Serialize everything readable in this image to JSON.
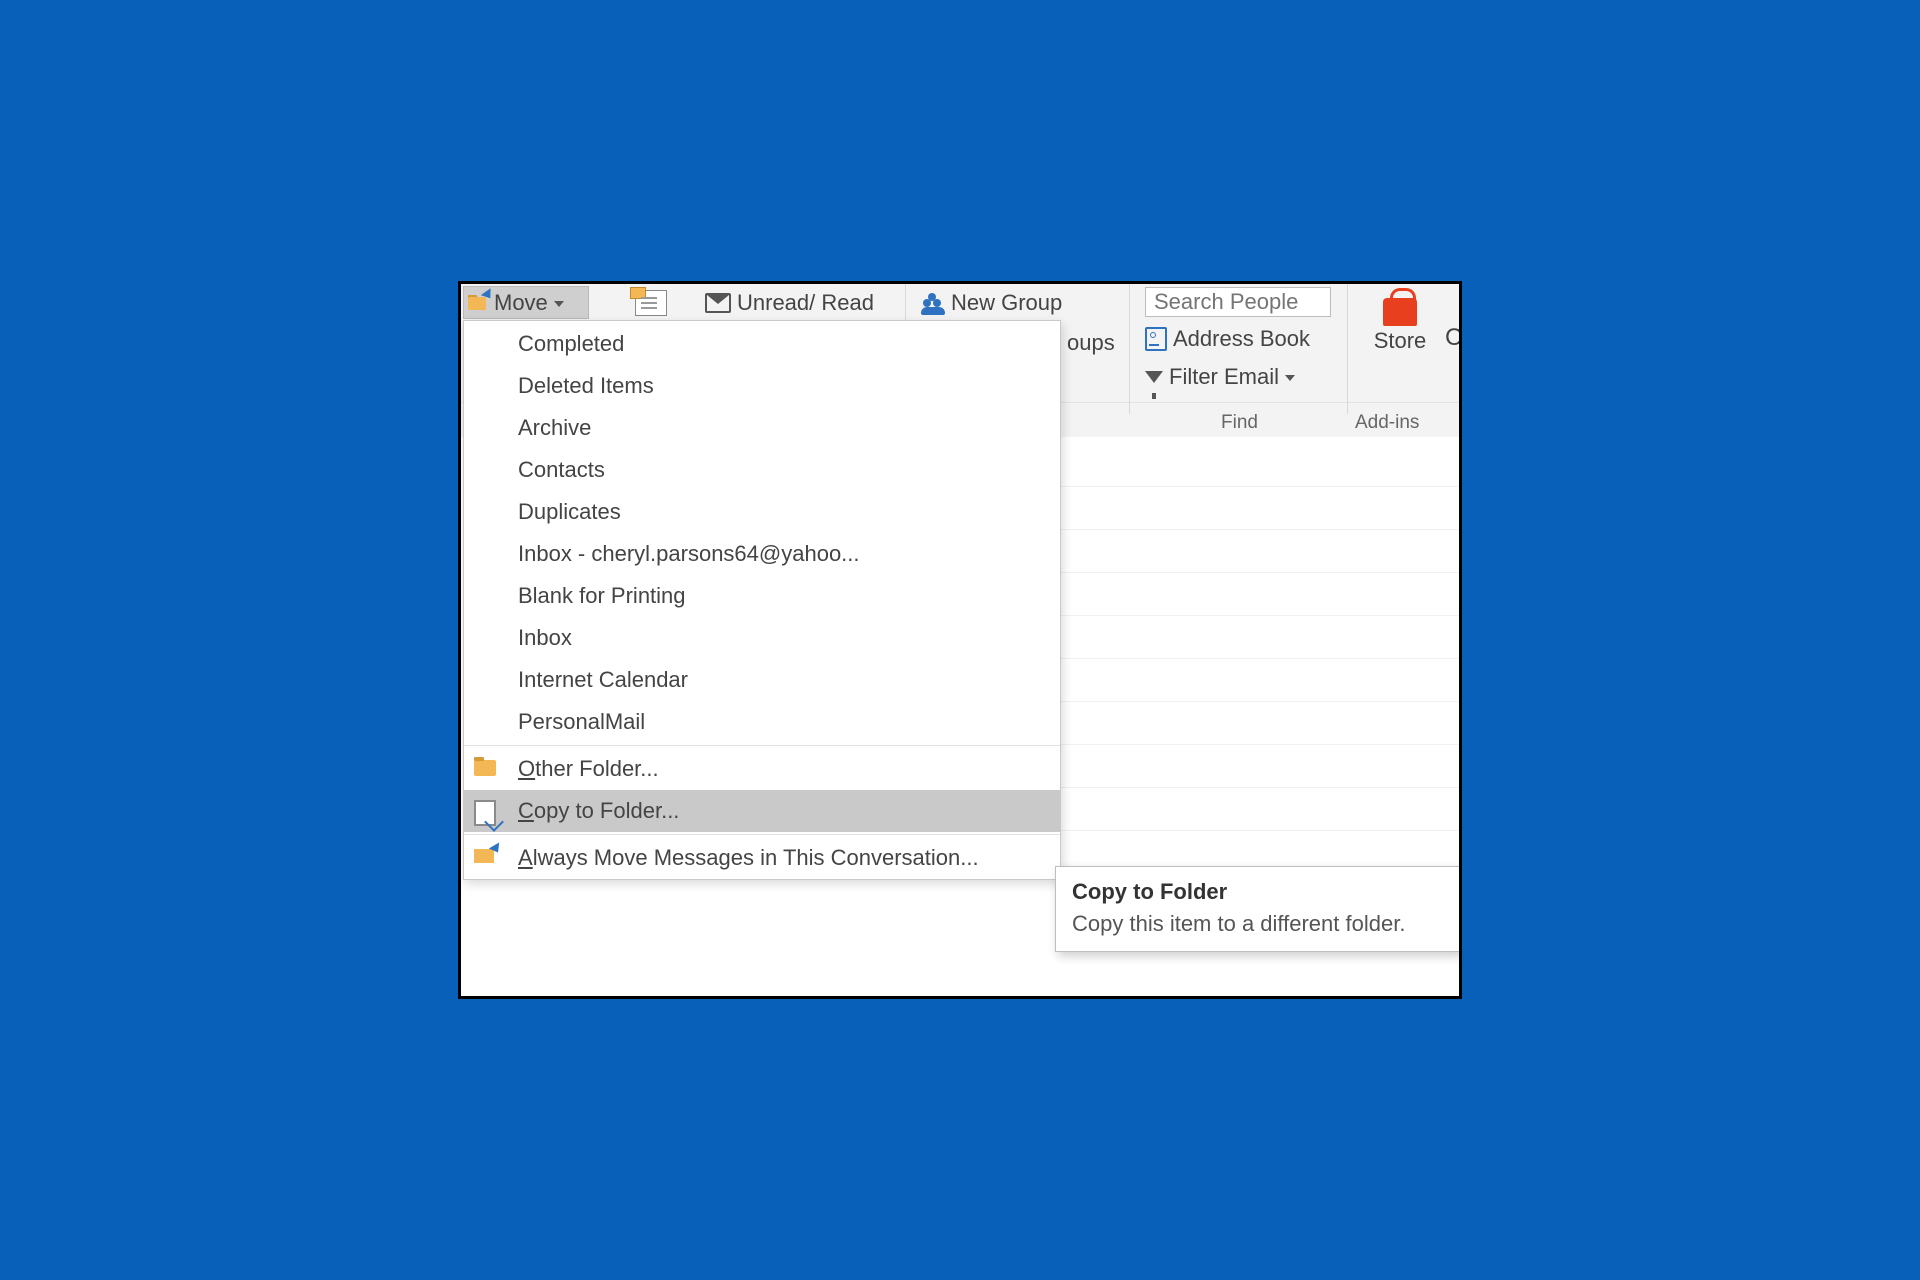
{
  "ribbon": {
    "move_label": "Move",
    "unread_label": "Unread/ Read",
    "newgroup_label": "New Group",
    "groups_fragment": "oups",
    "search_placeholder": "Search People",
    "address_book_label": "Address Book",
    "filter_label": "Filter Email",
    "find_group": "Find",
    "store_label": "Store",
    "addins_group": "Add-ins",
    "right_fragment": "C"
  },
  "menu": {
    "items": [
      "Completed",
      "Deleted Items",
      "Archive",
      "Contacts",
      "Duplicates",
      "Inbox - cheryl.parsons64@yahoo...",
      "Blank for Printing",
      "Inbox",
      "Internet Calendar",
      "PersonalMail"
    ],
    "other_prefix": "O",
    "other_rest": "ther Folder...",
    "copy_prefix": "C",
    "copy_rest": "opy to Folder...",
    "always_prefix": "A",
    "always_rest": "lways Move Messages in This Conversation..."
  },
  "tooltip": {
    "title": "Copy to Folder",
    "body": "Copy this item to a different folder."
  }
}
